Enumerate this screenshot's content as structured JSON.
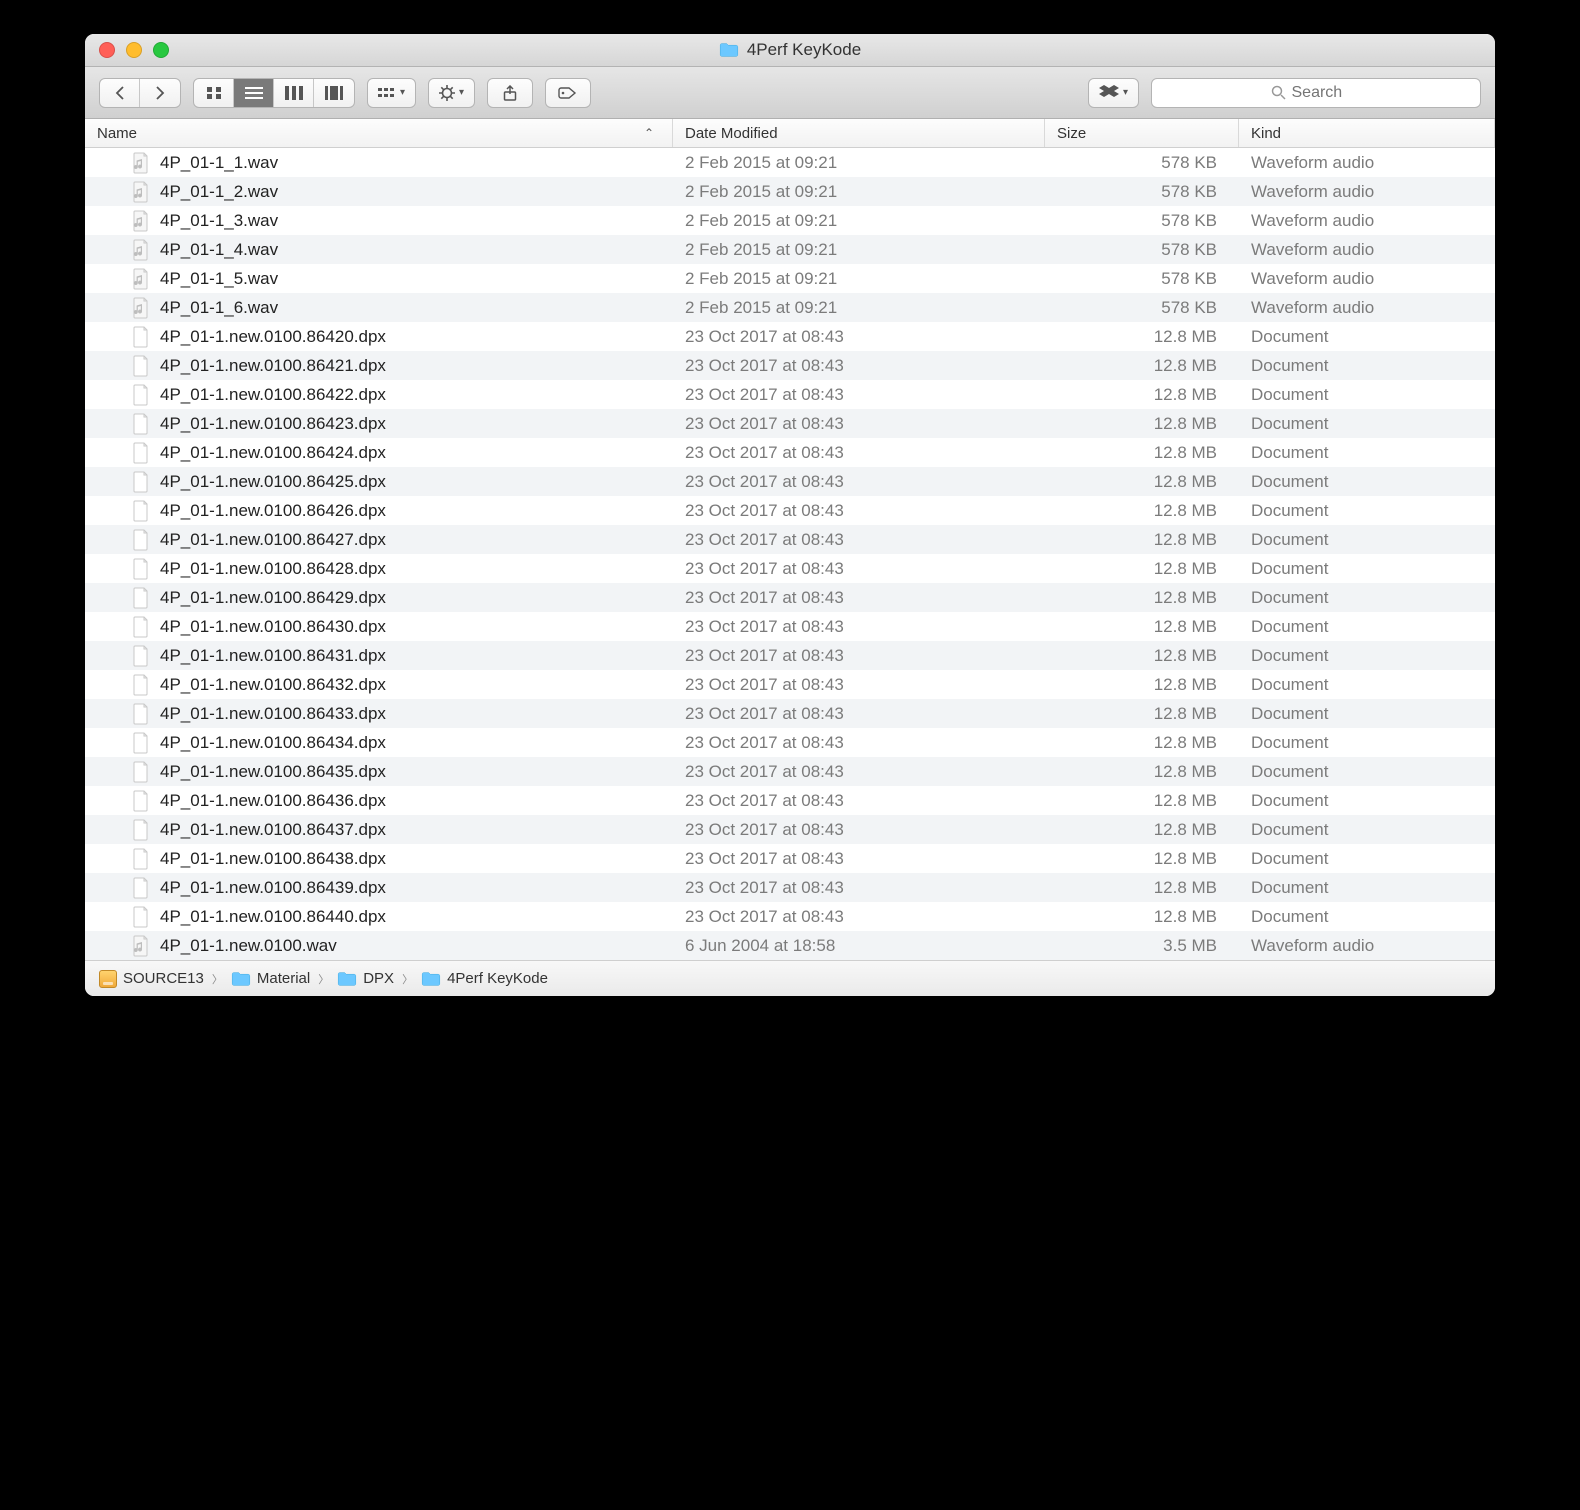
{
  "window": {
    "title": "4Perf KeyKode"
  },
  "columns": {
    "name": "Name",
    "date": "Date Modified",
    "size": "Size",
    "kind": "Kind"
  },
  "search": {
    "placeholder": "Search"
  },
  "path": [
    {
      "label": "SOURCE13",
      "icon": "disk"
    },
    {
      "label": "Material",
      "icon": "folder"
    },
    {
      "label": "DPX",
      "icon": "folder"
    },
    {
      "label": "4Perf KeyKode",
      "icon": "folder"
    }
  ],
  "files": [
    {
      "name": "4P_01-1_1.wav",
      "date": "2 Feb 2015 at 09:21",
      "size": "578 KB",
      "kind": "Waveform audio",
      "icon": "audio"
    },
    {
      "name": "4P_01-1_2.wav",
      "date": "2 Feb 2015 at 09:21",
      "size": "578 KB",
      "kind": "Waveform audio",
      "icon": "audio"
    },
    {
      "name": "4P_01-1_3.wav",
      "date": "2 Feb 2015 at 09:21",
      "size": "578 KB",
      "kind": "Waveform audio",
      "icon": "audio"
    },
    {
      "name": "4P_01-1_4.wav",
      "date": "2 Feb 2015 at 09:21",
      "size": "578 KB",
      "kind": "Waveform audio",
      "icon": "audio"
    },
    {
      "name": "4P_01-1_5.wav",
      "date": "2 Feb 2015 at 09:21",
      "size": "578 KB",
      "kind": "Waveform audio",
      "icon": "audio"
    },
    {
      "name": "4P_01-1_6.wav",
      "date": "2 Feb 2015 at 09:21",
      "size": "578 KB",
      "kind": "Waveform audio",
      "icon": "audio"
    },
    {
      "name": "4P_01-1.new.0100.86420.dpx",
      "date": "23 Oct 2017 at 08:43",
      "size": "12.8 MB",
      "kind": "Document",
      "icon": "doc"
    },
    {
      "name": "4P_01-1.new.0100.86421.dpx",
      "date": "23 Oct 2017 at 08:43",
      "size": "12.8 MB",
      "kind": "Document",
      "icon": "doc"
    },
    {
      "name": "4P_01-1.new.0100.86422.dpx",
      "date": "23 Oct 2017 at 08:43",
      "size": "12.8 MB",
      "kind": "Document",
      "icon": "doc"
    },
    {
      "name": "4P_01-1.new.0100.86423.dpx",
      "date": "23 Oct 2017 at 08:43",
      "size": "12.8 MB",
      "kind": "Document",
      "icon": "doc"
    },
    {
      "name": "4P_01-1.new.0100.86424.dpx",
      "date": "23 Oct 2017 at 08:43",
      "size": "12.8 MB",
      "kind": "Document",
      "icon": "doc"
    },
    {
      "name": "4P_01-1.new.0100.86425.dpx",
      "date": "23 Oct 2017 at 08:43",
      "size": "12.8 MB",
      "kind": "Document",
      "icon": "doc"
    },
    {
      "name": "4P_01-1.new.0100.86426.dpx",
      "date": "23 Oct 2017 at 08:43",
      "size": "12.8 MB",
      "kind": "Document",
      "icon": "doc"
    },
    {
      "name": "4P_01-1.new.0100.86427.dpx",
      "date": "23 Oct 2017 at 08:43",
      "size": "12.8 MB",
      "kind": "Document",
      "icon": "doc"
    },
    {
      "name": "4P_01-1.new.0100.86428.dpx",
      "date": "23 Oct 2017 at 08:43",
      "size": "12.8 MB",
      "kind": "Document",
      "icon": "doc"
    },
    {
      "name": "4P_01-1.new.0100.86429.dpx",
      "date": "23 Oct 2017 at 08:43",
      "size": "12.8 MB",
      "kind": "Document",
      "icon": "doc"
    },
    {
      "name": "4P_01-1.new.0100.86430.dpx",
      "date": "23 Oct 2017 at 08:43",
      "size": "12.8 MB",
      "kind": "Document",
      "icon": "doc"
    },
    {
      "name": "4P_01-1.new.0100.86431.dpx",
      "date": "23 Oct 2017 at 08:43",
      "size": "12.8 MB",
      "kind": "Document",
      "icon": "doc"
    },
    {
      "name": "4P_01-1.new.0100.86432.dpx",
      "date": "23 Oct 2017 at 08:43",
      "size": "12.8 MB",
      "kind": "Document",
      "icon": "doc"
    },
    {
      "name": "4P_01-1.new.0100.86433.dpx",
      "date": "23 Oct 2017 at 08:43",
      "size": "12.8 MB",
      "kind": "Document",
      "icon": "doc"
    },
    {
      "name": "4P_01-1.new.0100.86434.dpx",
      "date": "23 Oct 2017 at 08:43",
      "size": "12.8 MB",
      "kind": "Document",
      "icon": "doc"
    },
    {
      "name": "4P_01-1.new.0100.86435.dpx",
      "date": "23 Oct 2017 at 08:43",
      "size": "12.8 MB",
      "kind": "Document",
      "icon": "doc"
    },
    {
      "name": "4P_01-1.new.0100.86436.dpx",
      "date": "23 Oct 2017 at 08:43",
      "size": "12.8 MB",
      "kind": "Document",
      "icon": "doc"
    },
    {
      "name": "4P_01-1.new.0100.86437.dpx",
      "date": "23 Oct 2017 at 08:43",
      "size": "12.8 MB",
      "kind": "Document",
      "icon": "doc"
    },
    {
      "name": "4P_01-1.new.0100.86438.dpx",
      "date": "23 Oct 2017 at 08:43",
      "size": "12.8 MB",
      "kind": "Document",
      "icon": "doc"
    },
    {
      "name": "4P_01-1.new.0100.86439.dpx",
      "date": "23 Oct 2017 at 08:43",
      "size": "12.8 MB",
      "kind": "Document",
      "icon": "doc"
    },
    {
      "name": "4P_01-1.new.0100.86440.dpx",
      "date": "23 Oct 2017 at 08:43",
      "size": "12.8 MB",
      "kind": "Document",
      "icon": "doc"
    },
    {
      "name": "4P_01-1.new.0100.wav",
      "date": "6 Jun 2004 at 18:58",
      "size": "3.5 MB",
      "kind": "Waveform audio",
      "icon": "audio"
    }
  ]
}
